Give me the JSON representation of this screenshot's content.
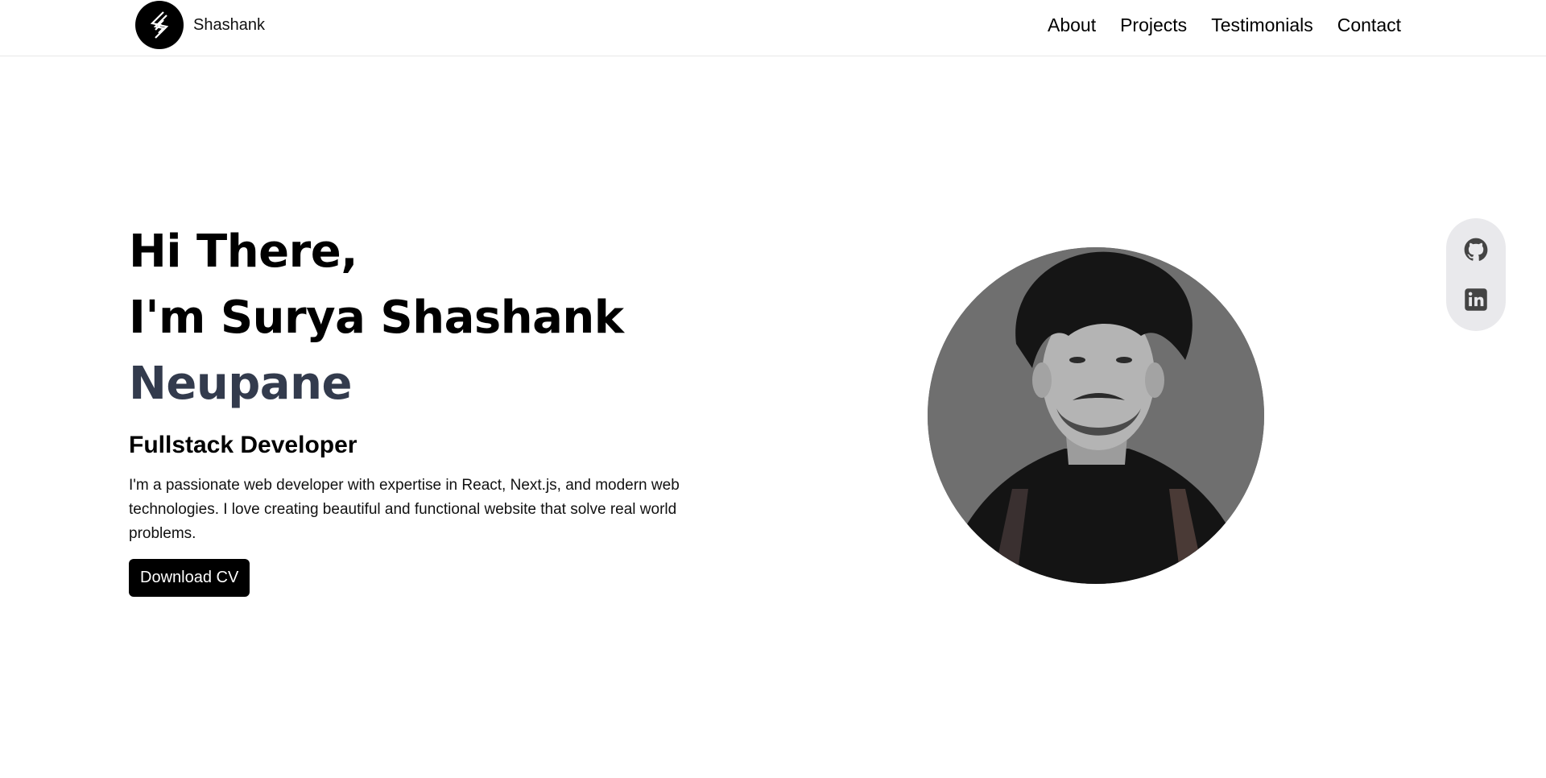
{
  "header": {
    "brand_name": "Shashank",
    "logo_icon": "s-monogram-logo",
    "nav": [
      "About",
      "Projects",
      "Testimonials",
      "Contact"
    ]
  },
  "hero": {
    "greeting_line1": "Hi There,",
    "greeting_line2": "I'm Surya Shashank",
    "greeting_line3": "Neupane",
    "role": "Fullstack Developer",
    "bio": "I'm a passionate web developer with expertise in React, Next.js, and modern web technologies. I love creating beautiful and functional website that solve real world problems.",
    "cta_label": "Download CV",
    "accent_color": "#333b4d",
    "portrait": "profile-photo"
  },
  "social": {
    "items": [
      {
        "icon": "github-icon"
      },
      {
        "icon": "linkedin-icon"
      }
    ],
    "icon_color": "#444444",
    "rail_color": "#e9e9ec"
  }
}
